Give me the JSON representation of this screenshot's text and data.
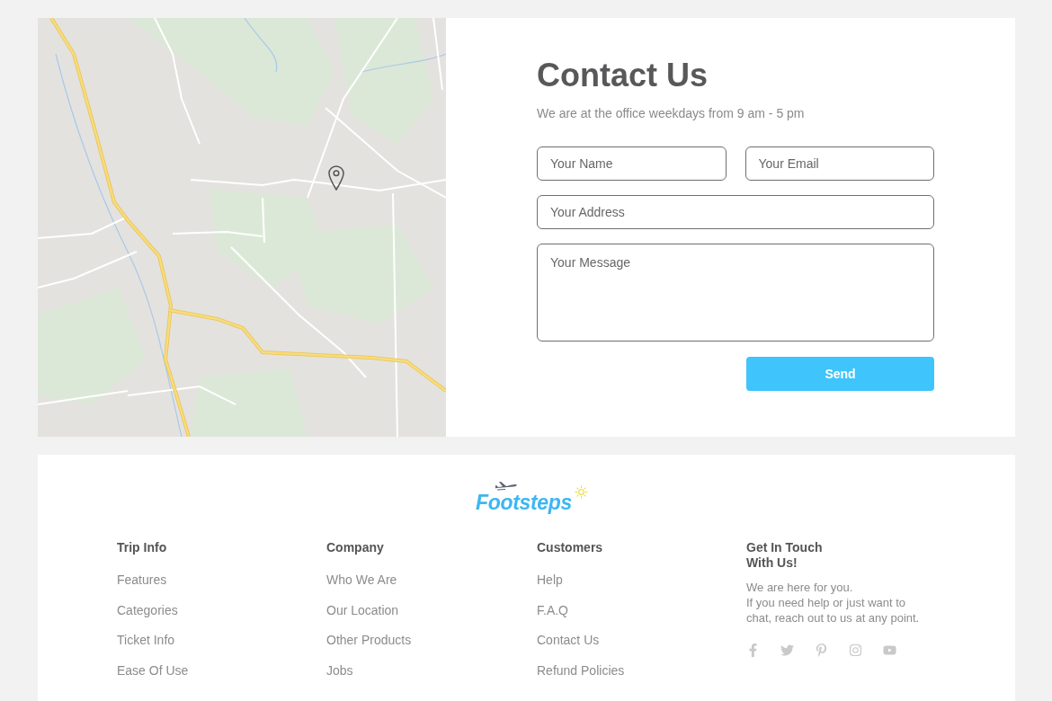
{
  "contact": {
    "title": "Contact Us",
    "subtitle": "We are at the office weekdays from 9 am - 5 pm",
    "fields": [
      {
        "kind": "input",
        "placeholder": "Your Name"
      },
      {
        "kind": "input",
        "placeholder": "Your Email"
      },
      {
        "kind": "input",
        "placeholder": "Your Address"
      },
      {
        "kind": "textarea",
        "placeholder": "Your Message"
      }
    ],
    "submit": "Send"
  },
  "footer": {
    "logo": "Footsteps",
    "columns": [
      {
        "heading": "Trip Info",
        "links": [
          "Features",
          "Categories",
          "Ticket Info",
          "Ease Of Use"
        ]
      },
      {
        "heading": "Company",
        "links": [
          "Who We Are",
          "Our Location",
          "Other Products",
          "Jobs"
        ]
      },
      {
        "heading": "Customers",
        "links": [
          "Help",
          "F.A.Q",
          "Contact Us",
          "Refund Policies"
        ]
      }
    ],
    "get_in_touch": {
      "heading": "Get In Touch With Us!",
      "text": "We are here for you.\nIf you need help or just want to chat, reach out to us at any point."
    }
  }
}
